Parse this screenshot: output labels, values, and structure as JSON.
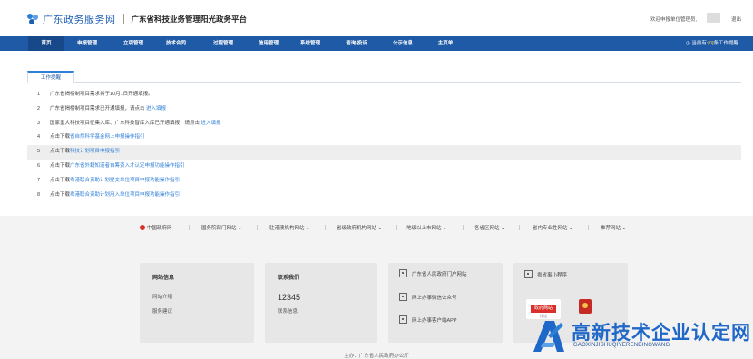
{
  "header": {
    "site_name": "广东政务服务网",
    "platform_title": "广东省科技业务管理阳光政务平台",
    "welcome": "欢迎申报单位管理员,",
    "logout": "退出"
  },
  "nav": {
    "items": [
      "首页",
      "申报管理",
      "立项管理",
      "技术合同",
      "过程管理",
      "信用管理",
      "系统管理",
      "咨询/投诉",
      "公示信息",
      "主页单"
    ],
    "active": "首页",
    "right_prefix": "当前有:",
    "right_count": "[0]",
    "right_suffix": "条工作提醒"
  },
  "work": {
    "tab": "工作提醒",
    "notices": [
      {
        "num": "1",
        "text": "广东省揭榜制项目需求将于10月1日开通填报。",
        "link": ""
      },
      {
        "num": "2",
        "text": "广东省揭榜制项目需求已开通填报，请点击",
        "link": "进入填报"
      },
      {
        "num": "3",
        "text": "国家重大科技项目征集入库、广东科技智库入库已开通填报，请点击",
        "link": "进入填报"
      },
      {
        "num": "4",
        "text": "点击下载",
        "link": "省自然科学基金网上申报操作指引"
      },
      {
        "num": "5",
        "text": "点击下载",
        "link": "科技计划项目申报指引"
      },
      {
        "num": "6",
        "text": "点击下载",
        "link": "广东省外籍知道者自筹资入才认定申报功能操作指引"
      },
      {
        "num": "7",
        "text": "点击下载",
        "link": "粤港联合资助计划提交单位项目申报功能操作指引"
      },
      {
        "num": "8",
        "text": "点击下载",
        "link": "粤港联合资助计划用入单位项目申报功能操作指引"
      }
    ]
  },
  "footer": {
    "links": [
      "中国政府网",
      "国务院部门网站",
      "驻港澳机构网站",
      "省级政府机构网站",
      "地级以上市网站",
      "各省区网站",
      "省内专业性网站",
      "推荐网站"
    ],
    "site_info": {
      "title": "网站信息",
      "items": [
        "网站介绍",
        "服务建议"
      ]
    },
    "contact": {
      "title": "联系我们",
      "phone": "12345",
      "items": [
        "联系信息"
      ]
    },
    "qr_links": [
      "广东省人民政府门户网站",
      "网上办事微信公众号",
      "网上办事客户端APP"
    ],
    "miniapp": "粤省事小程序",
    "badge_text": "政府网站",
    "badge_sub": "找错",
    "sponsor": "主办：广东省人民政府办公厅"
  },
  "watermark": {
    "title": "高新技术企业认定网",
    "subtitle": "GAOXINJISHUQIYERENDINGWANG"
  },
  "colors": {
    "nav_bg": "#1f5aa6",
    "link": "#2f7fd6",
    "accent_red": "#d9302b",
    "watermark": "#1f68c8"
  }
}
